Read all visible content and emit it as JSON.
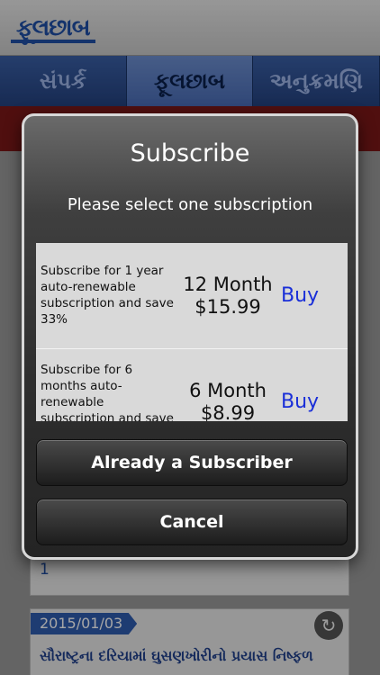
{
  "app": {
    "logo": "ફૂલછાબ",
    "nav_tabs": [
      {
        "label": "સંપર્ક"
      },
      {
        "label": "ફૂલછાબ"
      },
      {
        "label": "અનુક્રમણિ"
      }
    ],
    "page_indicator": "1",
    "news": {
      "date": "2015/01/03",
      "headline": "સૌરાષ્ટ્રના દરિયામાં ઘુસણખોરીનો પ્રયાસ નિષ્ફળ"
    }
  },
  "dialog": {
    "title": "Subscribe",
    "subtitle": "Please select one subscription",
    "plans": [
      {
        "description": "Subscribe for 1 year auto-renewable subscription and save 33%",
        "duration": "12 Month",
        "price": "$15.99",
        "buy_label": "Buy"
      },
      {
        "description": "Subscribe for 6 months auto-renewable subscription and save",
        "duration": "6 Month",
        "price": "$8.99",
        "buy_label": "Buy"
      }
    ],
    "already_subscriber_label": "Already a Subscriber",
    "cancel_label": "Cancel"
  }
}
